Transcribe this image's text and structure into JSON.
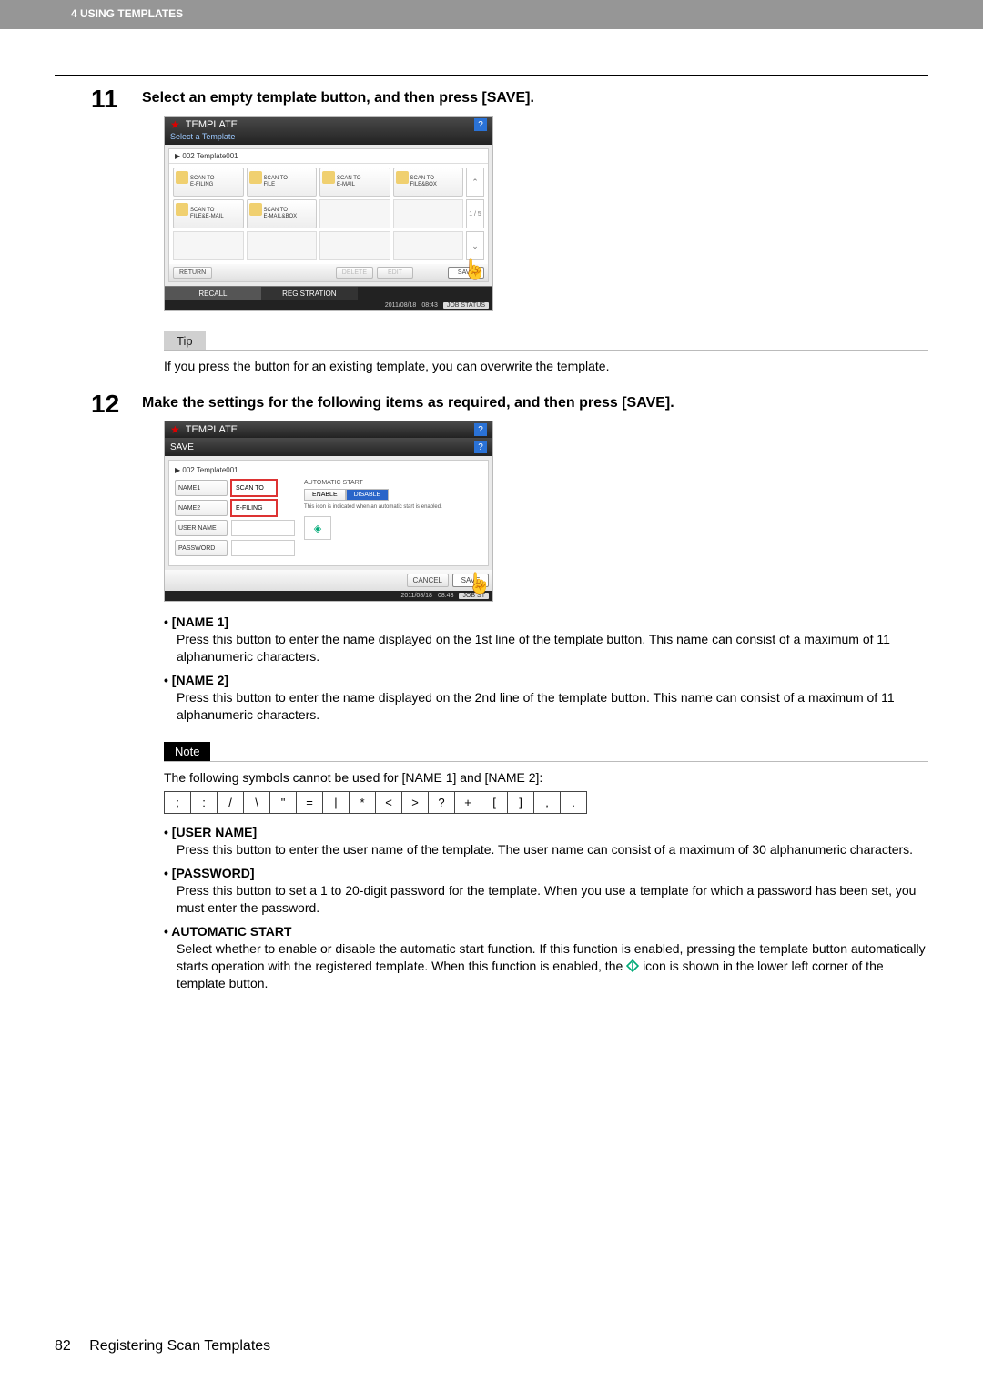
{
  "header": {
    "chapter": "4 USING TEMPLATES"
  },
  "step11": {
    "num": "11",
    "title": "Select an empty template button, and then press [SAVE].",
    "panel": {
      "title": "TEMPLATE",
      "subtitle": "Select a Template",
      "breadcrumb": "▶  002  Template001",
      "templates": [
        {
          "l1": "SCAN TO",
          "l2": "E-FILING"
        },
        {
          "l1": "SCAN TO",
          "l2": "FILE"
        },
        {
          "l1": "SCAN TO",
          "l2": "E-MAIL"
        },
        {
          "l1": "SCAN TO",
          "l2": "FILE&BOX"
        },
        {
          "l1": "SCAN TO",
          "l2": "FILE&E-MAIL"
        },
        {
          "l1": "SCAN TO",
          "l2": "E-MAIL&BOX"
        }
      ],
      "page_ind": "1 / 5",
      "buttons": {
        "return": "RETURN",
        "delete": "DELETE",
        "edit": "EDIT",
        "save": "SAVE"
      },
      "tabs": {
        "recall": "RECALL",
        "registration": "REGISTRATION"
      },
      "status": {
        "date": "2011/08/18",
        "time": "08:43",
        "job": "JOB STATUS"
      }
    },
    "tip_label": "Tip",
    "tip_text": "If you press the button for an existing template, you can overwrite the template."
  },
  "step12": {
    "num": "12",
    "title": "Make the settings for the following items as required, and then press [SAVE].",
    "panel": {
      "title": "TEMPLATE",
      "sub": "SAVE",
      "breadcrumb": "▶  002  Template001",
      "fields": {
        "name1_label": "NAME1",
        "name1_val": "SCAN TO",
        "name2_label": "NAME2",
        "name2_val": "E-FILING",
        "user_label": "USER NAME",
        "pass_label": "PASSWORD"
      },
      "right": {
        "heading": "AUTOMATIC START",
        "enable": "ENABLE",
        "disable": "DISABLE",
        "hint": "This icon is indicated when an automatic start is enabled."
      },
      "buttons": {
        "cancel": "CANCEL",
        "save": "SAVE"
      },
      "status": {
        "date": "2011/08/18",
        "time": "08:43",
        "job": "JOB ST"
      }
    },
    "items": {
      "name1": {
        "label": "[NAME 1]",
        "desc": "Press this button to enter the name displayed on the 1st line of the template button. This name can consist of a maximum of 11 alphanumeric characters."
      },
      "name2": {
        "label": "[NAME 2]",
        "desc": "Press this button to enter the name displayed on the 2nd line of the template button. This name can consist of a maximum of 11 alphanumeric characters."
      },
      "note_label": "Note",
      "note_text": "The following symbols cannot be used for [NAME 1] and [NAME 2]:",
      "symbols": [
        ";",
        ":",
        "/",
        "\\",
        "\"",
        "=",
        "|",
        "*",
        "<",
        ">",
        "?",
        "+",
        "[",
        "]",
        ",",
        "."
      ],
      "user": {
        "label": "[USER NAME]",
        "desc": "Press this button to enter the user name of the template. The user name can consist of a maximum of 30 alphanumeric characters."
      },
      "password": {
        "label": "[PASSWORD]",
        "desc": "Press this button to set a 1 to 20-digit password for the template. When you use a template for which a password has been set, you must enter the password."
      },
      "autostart": {
        "label": "AUTOMATIC START",
        "desc1": "Select whether to enable or disable the automatic start function. If this function is enabled, pressing the template button automatically starts operation with the registered template. When this function is enabled, the ",
        "desc2": " icon is shown in the lower left corner of the template button."
      }
    }
  },
  "footer": {
    "page": "82",
    "title": "Registering Scan Templates"
  }
}
